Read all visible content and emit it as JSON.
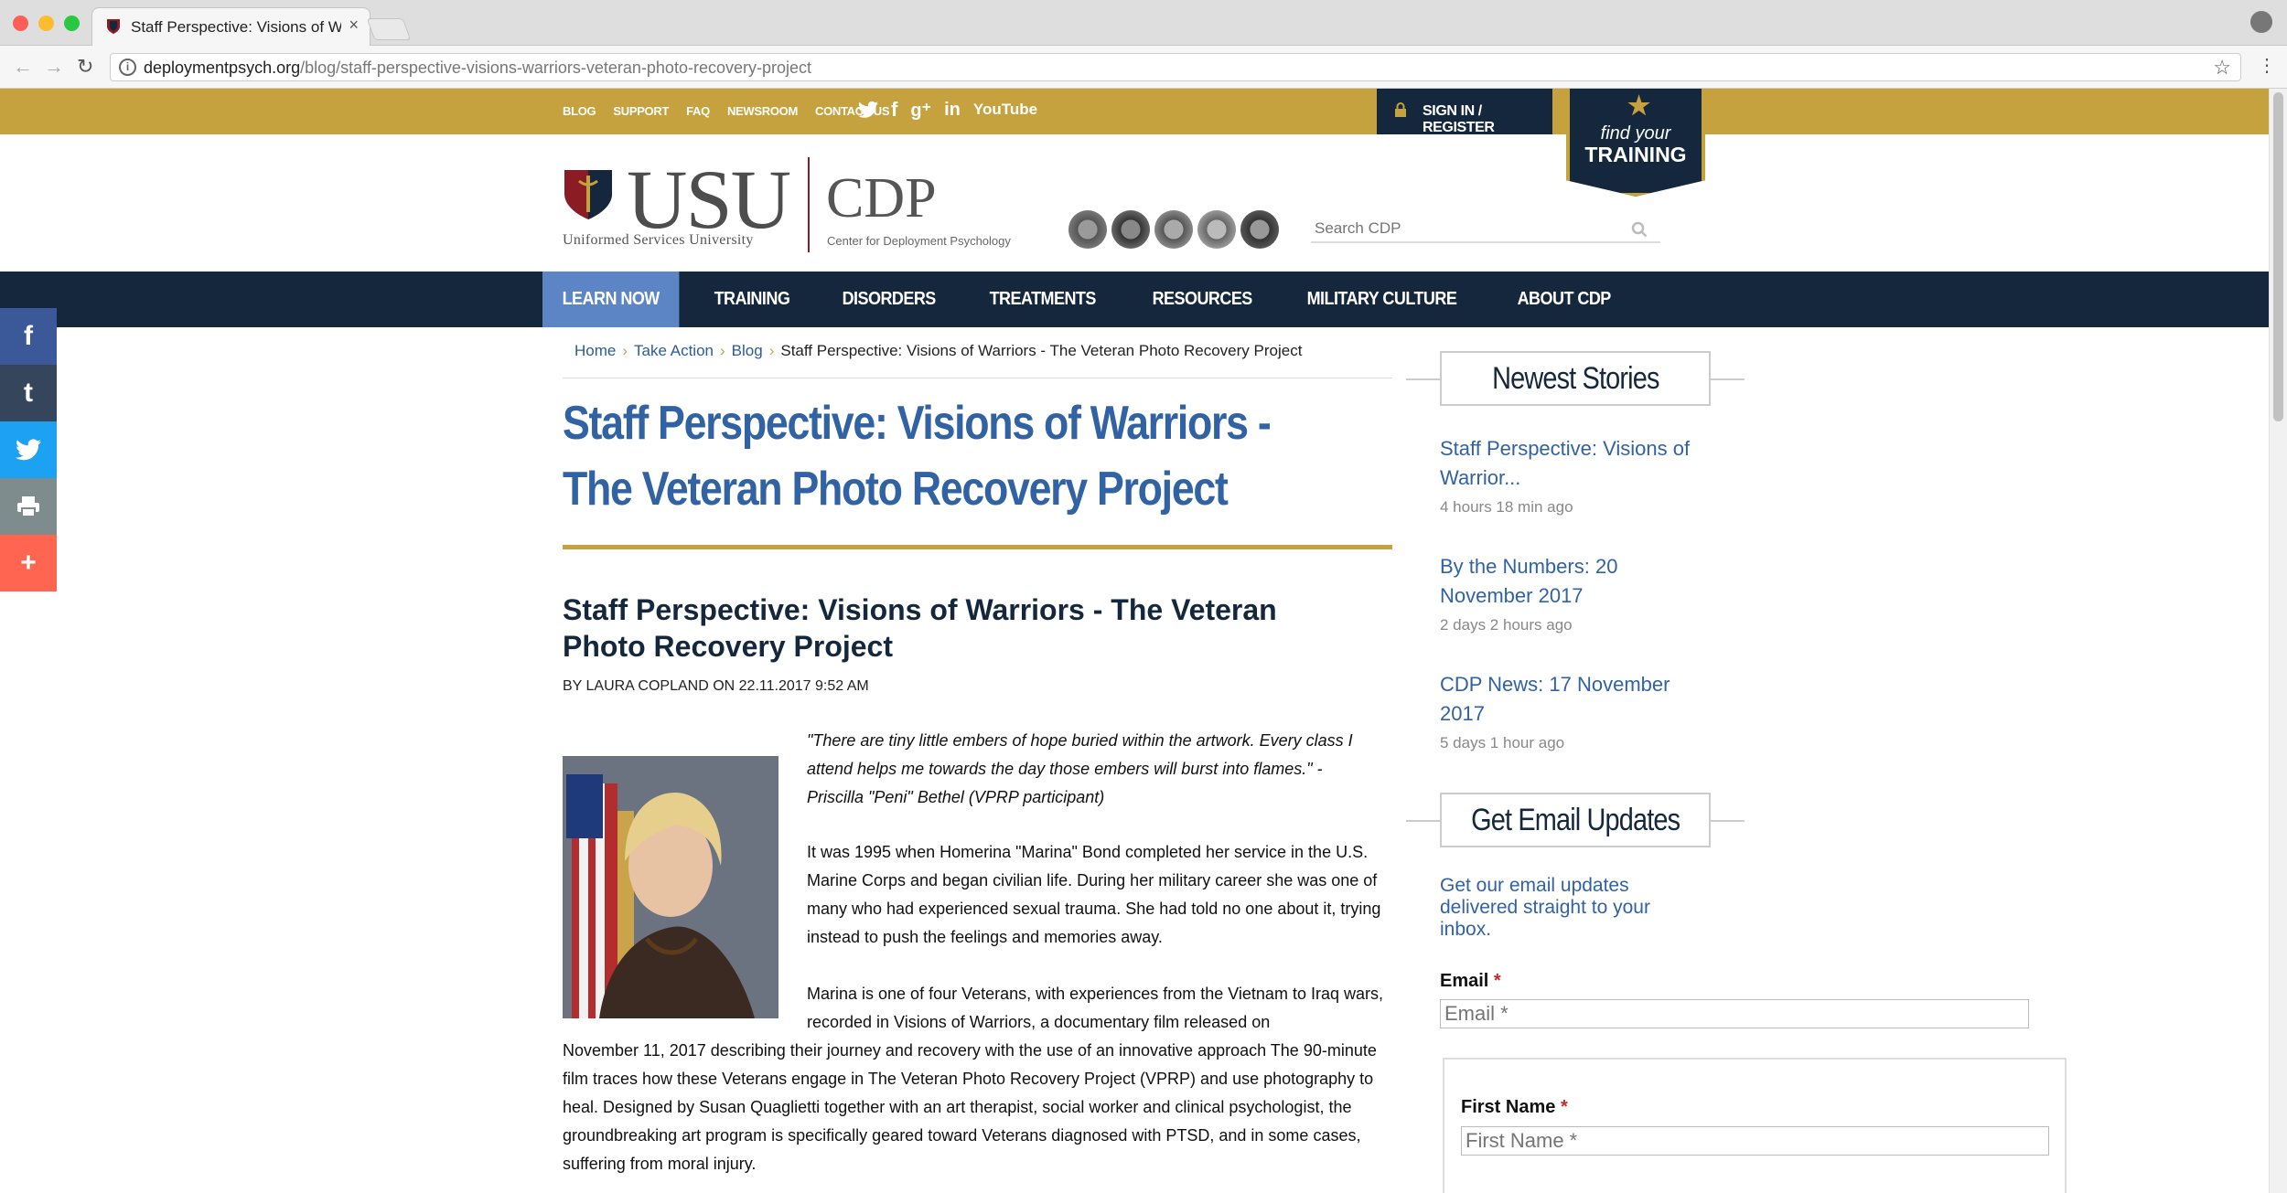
{
  "browser": {
    "tab_title": "Staff Perspective: Visions of W",
    "tab_close": "×",
    "url_domain": "deploymentpsych.org",
    "url_path": "/blog/staff-perspective-visions-warriors-veteran-photo-recovery-project",
    "info_glyph": "i",
    "star_glyph": "☆",
    "kebab_glyph": "⋮",
    "back_glyph": "←",
    "forward_glyph": "→",
    "reload_glyph": "↻"
  },
  "utility": {
    "links": [
      "BLOG",
      "SUPPORT",
      "FAQ",
      "NEWSROOM",
      "CONTACT US"
    ],
    "signin": "SIGN IN / REGISTER",
    "training_line1": "find your",
    "training_line2": "TRAINING",
    "youtube": "YouTube"
  },
  "logo": {
    "usu": "USU",
    "usu_sub": "Uniformed Services University",
    "cdp": "CDP",
    "cdp_sub": "Center for Deployment Psychology"
  },
  "search": {
    "placeholder": "Search CDP"
  },
  "nav": {
    "items": [
      "LEARN NOW",
      "TRAINING",
      "DISORDERS",
      "TREATMENTS",
      "RESOURCES",
      "MILITARY CULTURE",
      "ABOUT CDP"
    ]
  },
  "share": {
    "facebook": "f",
    "tumblr": "t",
    "twitter": "🐦",
    "print": "🖶",
    "more": "+"
  },
  "breadcrumb": {
    "home": "Home",
    "take_action": "Take Action",
    "blog": "Blog",
    "current": "Staff Perspective: Visions of Warriors - The Veteran Photo Recovery Project",
    "sep": "›"
  },
  "article": {
    "page_title": "Staff Perspective: Visions of Warriors - The Veteran Photo Recovery Project",
    "heading": "Staff Perspective: Visions of Warriors - The Veteran Photo Recovery Project",
    "byline": "BY LAURA COPLAND  ON 22.11.2017 9:52 AM",
    "quote": "\"There are tiny little embers of hope buried within the artwork. Every class I attend helps me towards the day those embers will burst into flames.\" - Priscilla \"Peni\" Bethel (VPRP participant)",
    "p1": "It was 1995 when Homerina \"Marina\" Bond completed her service in the U.S. Marine Corps and began civilian life. During her military career she was one of many who had experienced sexual trauma. She had told no one about it, trying instead to push the feelings and memories away.",
    "p2a": "Marina is one of four Veterans, with experiences from the Vietnam to Iraq wars, recorded in Visions of Warriors, a documentary film released on",
    "p2b": "November 11, 2017 describing their journey and recovery with the use of an innovative approach The 90-minute film traces how these Veterans engage in The Veteran Photo Recovery Project (VPRP) and use photography to heal. Designed by Susan Quaglietti together with an art therapist, social worker and clinical psychologist, the groundbreaking art program is specifically geared toward Veterans diagnosed with PTSD, and in some cases, suffering from moral injury."
  },
  "sidebar": {
    "newest_heading": "Newest Stories",
    "stories": [
      {
        "title": "Staff Perspective: Visions of Warrior...",
        "time": "4 hours 18 min ago"
      },
      {
        "title": "By the Numbers: 20 November 2017",
        "time": "2 days 2 hours ago"
      },
      {
        "title": "CDP News: 17 November 2017",
        "time": "5 days 1 hour ago"
      }
    ],
    "email_heading": "Get Email Updates",
    "email_blurb": "Get our email updates delivered straight to your inbox.",
    "email_label": "Email",
    "email_placeholder": "Email *",
    "first_name_label": "First Name",
    "first_name_placeholder": "First Name *",
    "required_mark": "*"
  },
  "colors": {
    "gold": "#c5a23e",
    "navy": "#14273d",
    "link_blue": "#3162a4",
    "nav_active": "#5b85c4",
    "facebook": "#3b5998",
    "tumblr": "#35465c",
    "twitter": "#1da1f2",
    "print": "#7f8c8d",
    "more": "#ff6550"
  }
}
